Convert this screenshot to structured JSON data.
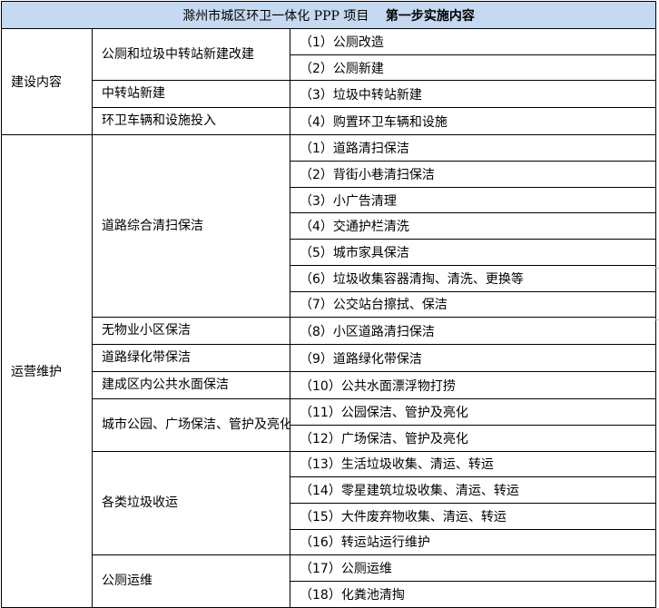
{
  "table": {
    "title_main": "滁州市城区环卫一体化 PPP 项目",
    "title_step": "第一步实施内容",
    "categories": [
      {
        "label": "建设内容",
        "groups": [
          {
            "label": "公厕和垃圾中转站新建改建",
            "items": [
              "（1）公厕改造",
              "（2）公厕新建"
            ]
          },
          {
            "label": "中转站新建",
            "items": [
              "（3）垃圾中转站新建"
            ]
          },
          {
            "label": "环卫车辆和设施投入",
            "items": [
              "（4）购置环卫车辆和设施"
            ]
          }
        ]
      },
      {
        "label": "运营维护",
        "groups": [
          {
            "label": "道路综合清扫保洁",
            "items": [
              "（1）道路清扫保洁",
              "（2）背街小巷清扫保洁",
              "（3）小广告清理",
              "（4）交通护栏清洗",
              "（5）城市家具保洁",
              "（6）垃圾收集容器清掏、清洗、更换等",
              "（7）公交站台擦拭、保洁"
            ]
          },
          {
            "label": "无物业小区保洁",
            "items": [
              "（8）小区道路清扫保洁"
            ]
          },
          {
            "label": "道路绿化带保洁",
            "items": [
              "（9）道路绿化带保洁"
            ]
          },
          {
            "label": "建成区内公共水面保洁",
            "items": [
              "（10）公共水面漂浮物打捞"
            ]
          },
          {
            "label": "城市公园、广场保洁、管护及亮化",
            "items": [
              "（11）公园保洁、管护及亮化",
              "（12）广场保洁、管护及亮化"
            ]
          },
          {
            "label": "各类垃圾收运",
            "items": [
              "（13）生活垃圾收集、清运、转运",
              "（14）零星建筑垃圾收集、清运、转运",
              "（15）大件废弃物收集、清运、转运",
              "（16）转运站运行维护"
            ]
          },
          {
            "label": "公厕运维",
            "items": [
              "（17）公厕运维",
              "（18）化粪池清掏"
            ]
          }
        ]
      }
    ]
  },
  "colors": {
    "header_bg": "#c5d9f1",
    "border": "#000000",
    "text": "#000000"
  }
}
